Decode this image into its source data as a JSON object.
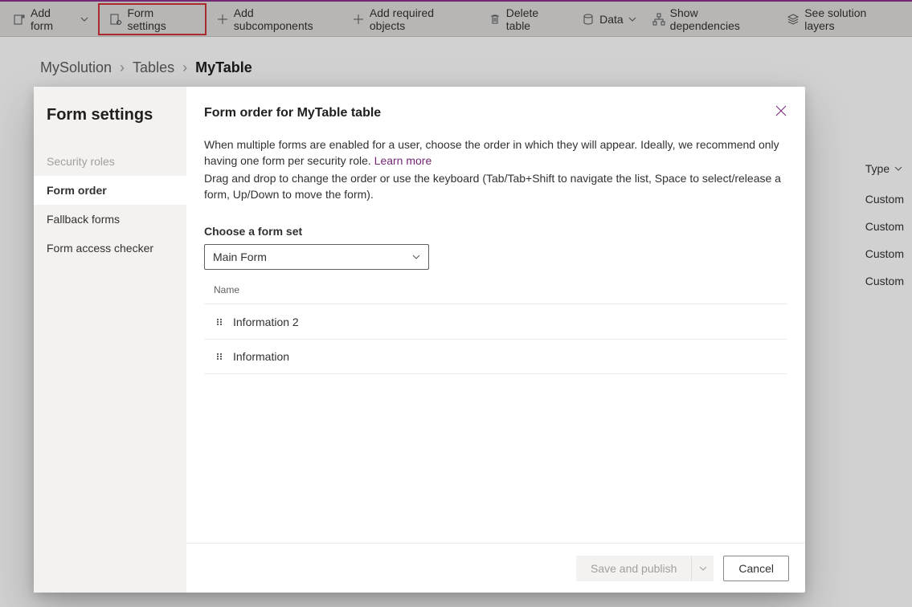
{
  "toolbar": {
    "add_form": "Add form",
    "form_settings": "Form settings",
    "add_subcomponents": "Add subcomponents",
    "add_required_objects": "Add required objects",
    "delete_table": "Delete table",
    "data": "Data",
    "show_dependencies": "Show dependencies",
    "see_solution_layers": "See solution layers"
  },
  "breadcrumb": {
    "solution": "MySolution",
    "tables": "Tables",
    "current": "MyTable"
  },
  "background_table": {
    "header_type": "Type",
    "rows": [
      "Custom",
      "Custom",
      "Custom",
      "Custom"
    ]
  },
  "dialog": {
    "sidebar_title": "Form settings",
    "sidebar_items": {
      "security_roles": "Security roles",
      "form_order": "Form order",
      "fallback_forms": "Fallback forms",
      "form_access_checker": "Form access checker"
    },
    "title": "Form order for MyTable table",
    "desc_line1": "When multiple forms are enabled for a user, choose the order in which they will appear. Ideally, we recommend only having one form per security role. ",
    "learn_more": "Learn more",
    "desc_line2": "Drag and drop to change the order or use the keyboard (Tab/Tab+Shift to navigate the list, Space to select/release a form, Up/Down to move the form).",
    "choose_label": "Choose a form set",
    "select_value": "Main Form",
    "list_header": "Name",
    "forms": [
      "Information 2",
      "Information"
    ],
    "save_publish": "Save and publish",
    "cancel": "Cancel"
  }
}
